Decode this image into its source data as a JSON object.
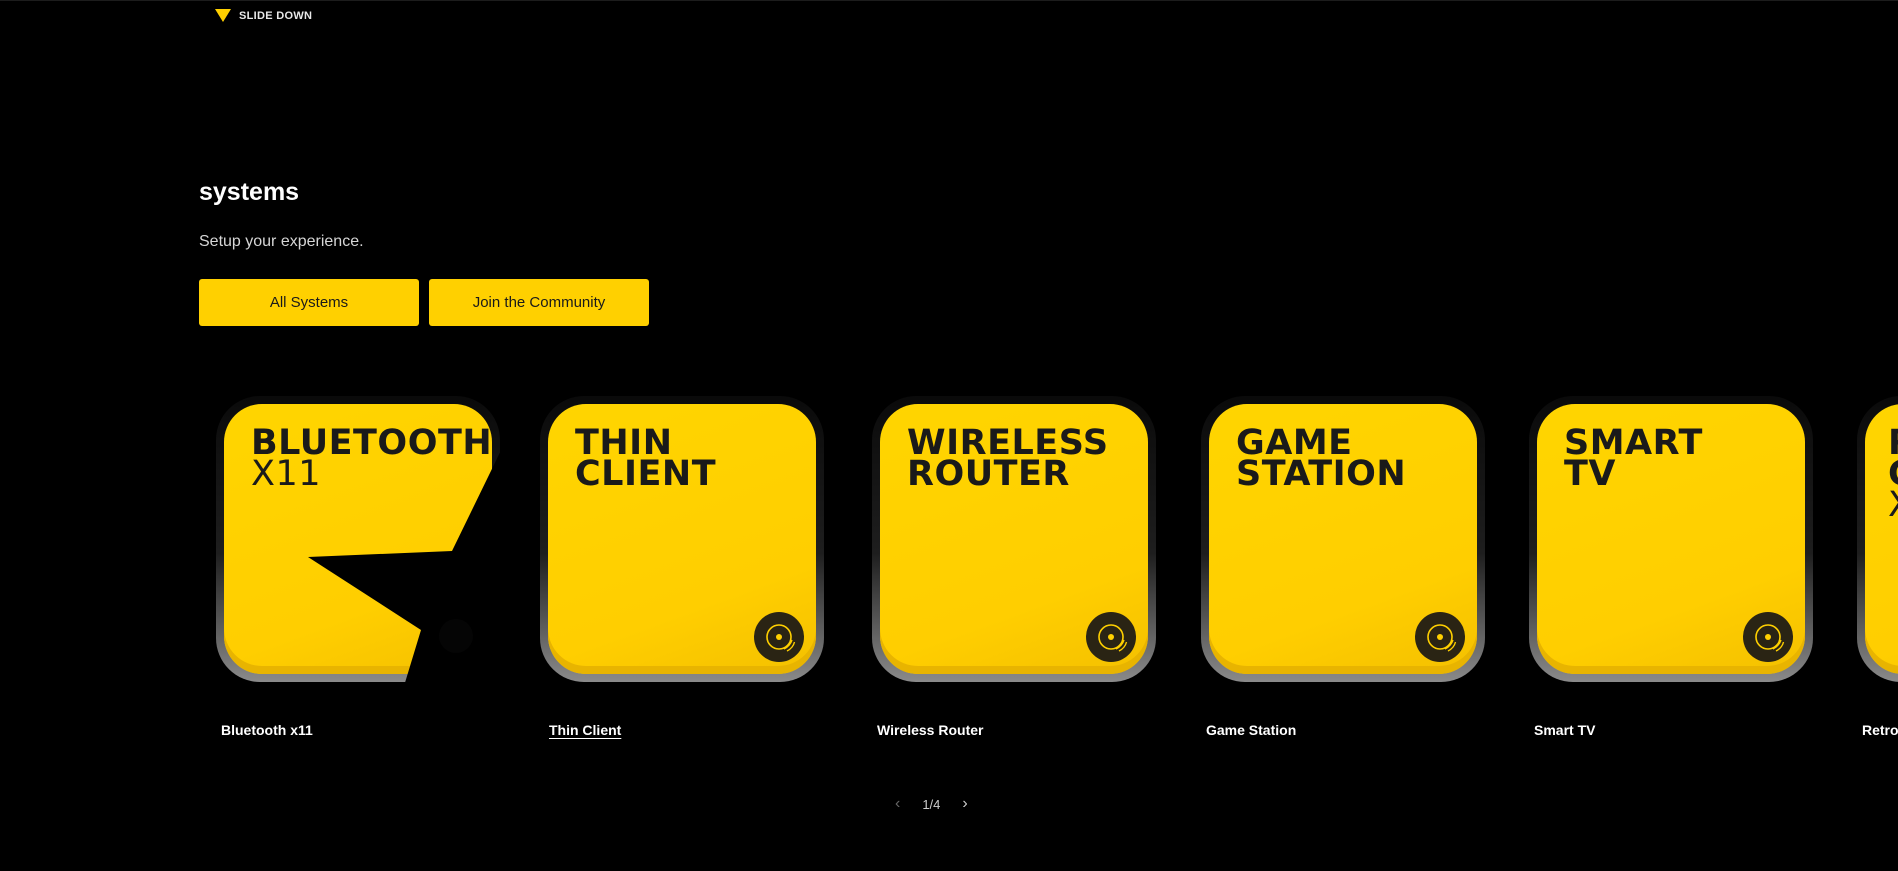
{
  "header": {
    "slide_down_label": "SLIDE DOWN"
  },
  "section": {
    "title": "systems",
    "subtitle": "Setup your experience.",
    "buttons": {
      "all_systems": "All Systems",
      "join_community": "Join the Community"
    }
  },
  "cards": [
    {
      "line1": "BLUETOOTH",
      "line2": "X11",
      "caption": "Bluetooth x11"
    },
    {
      "line1": "THIN",
      "line2": "CLIENT",
      "caption": "Thin Client"
    },
    {
      "line1": "WIRELESS",
      "line2": "ROUTER",
      "caption": "Wireless Router"
    },
    {
      "line1": "GAME",
      "line2": "STATION",
      "caption": "Game Station"
    },
    {
      "line1": "SMART",
      "line2": "TV",
      "caption": "Smart TV"
    },
    {
      "line1": "R",
      "line2": "G",
      "line3": "X",
      "caption": "Retro G"
    }
  ],
  "pager": {
    "prev": "‹",
    "status": "1/4",
    "next": "›"
  },
  "colors": {
    "accent": "#ffd000",
    "background": "#000000"
  }
}
